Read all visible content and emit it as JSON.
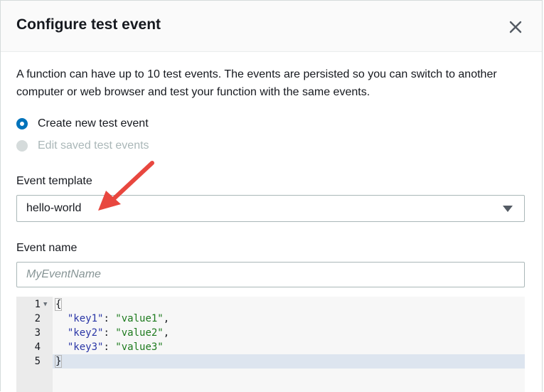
{
  "dialog": {
    "title": "Configure test event",
    "close_icon": "close-icon",
    "description": "A function can have up to 10 test events. The events are persisted so you can switch to another computer or web browser and test your function with the same events."
  },
  "radio_options": [
    {
      "label": "Create new test event",
      "selected": true,
      "disabled": false
    },
    {
      "label": "Edit saved test events",
      "selected": false,
      "disabled": true
    }
  ],
  "event_template": {
    "label": "Event template",
    "value": "hello-world"
  },
  "event_name": {
    "label": "Event name",
    "value": "",
    "placeholder": "MyEventName"
  },
  "editor": {
    "lines": [
      {
        "number": "1",
        "text": "{"
      },
      {
        "number": "2",
        "key": "\"key1\"",
        "value": "\"value1\"",
        "trail": ","
      },
      {
        "number": "3",
        "key": "\"key2\"",
        "value": "\"value2\"",
        "trail": ","
      },
      {
        "number": "4",
        "key": "\"key3\"",
        "value": "\"value3\"",
        "trail": ""
      },
      {
        "number": "5",
        "text": "}"
      }
    ],
    "active_line": 5
  },
  "colors": {
    "accent": "#0073bb",
    "annotation_arrow": "#e8473f"
  }
}
